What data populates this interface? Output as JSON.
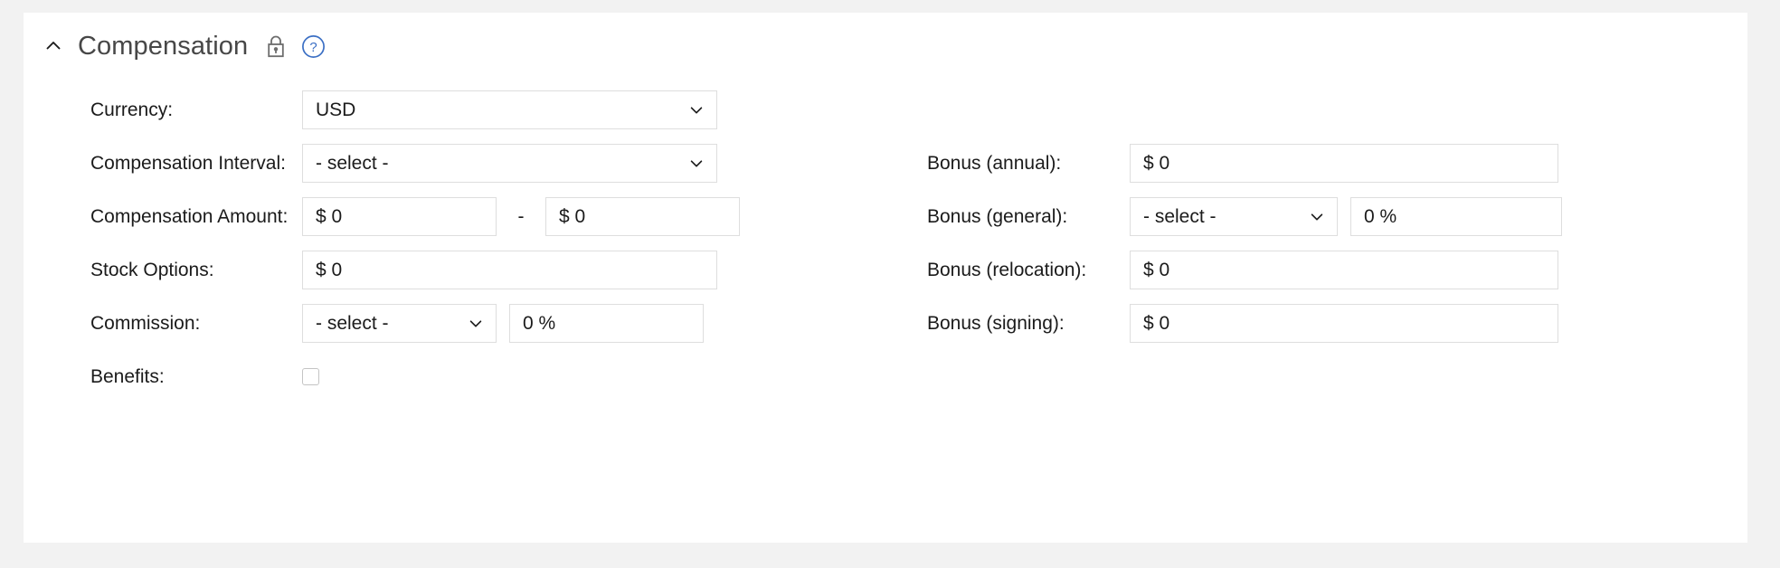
{
  "section": {
    "title": "Compensation",
    "collapse_icon": "chevron-up-icon",
    "lock_icon": "lock-icon",
    "help_icon": "help-circle-icon",
    "accent_color": "#3b6fc4",
    "title_color": "#474747",
    "border_color": "#dedede",
    "page_background": "#f2f2f2",
    "card_background": "#ffffff"
  },
  "fields": {
    "currency": {
      "label": "Currency:",
      "value": "USD",
      "chevron": "chevron-down-icon"
    },
    "compensation_interval": {
      "label": "Compensation Interval:",
      "value": "- select -",
      "chevron": "chevron-down-icon"
    },
    "compensation_amount": {
      "label": "Compensation Amount:",
      "min_value": "$ 0",
      "separator": "-",
      "max_value": "$ 0"
    },
    "stock_options": {
      "label": "Stock Options:",
      "value": "$ 0"
    },
    "commission": {
      "label": "Commission:",
      "select_value": "- select -",
      "chevron": "chevron-down-icon",
      "percent_value": "0 %"
    },
    "benefits": {
      "label": "Benefits:",
      "checked": false
    },
    "bonus_annual": {
      "label": "Bonus (annual):",
      "value": "$ 0"
    },
    "bonus_general": {
      "label": "Bonus (general):",
      "select_value": "- select -",
      "chevron": "chevron-down-icon",
      "percent_value": "0 %"
    },
    "bonus_relocation": {
      "label": "Bonus (relocation):",
      "value": "$ 0"
    },
    "bonus_signing": {
      "label": "Bonus (signing):",
      "value": "$ 0"
    }
  }
}
